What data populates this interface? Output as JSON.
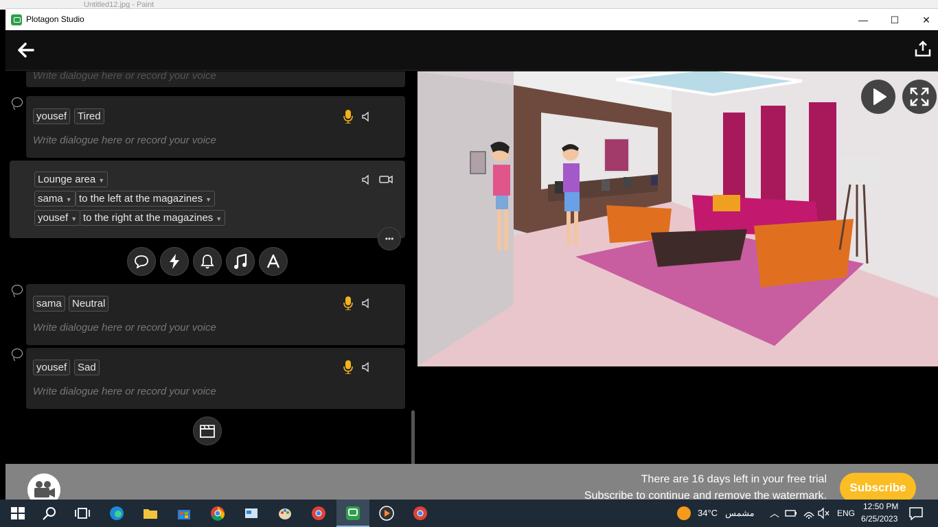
{
  "behind_window": {
    "title": "Untitled12.jpg - Paint"
  },
  "window": {
    "title": "Plotagon Studio",
    "controls": {
      "minimize": "—",
      "maximize": "☐",
      "close": "✕"
    }
  },
  "script": {
    "placeholder": "Write dialogue here or record your voice",
    "dialogues": [
      {
        "character": "yousef",
        "emotion": "Tired"
      },
      {
        "character": "sama",
        "emotion": "Neutral"
      },
      {
        "character": "yousef",
        "emotion": "Sad"
      }
    ],
    "scene": {
      "location": "Lounge area",
      "placements": [
        {
          "character": "sama",
          "position": "to the left at the magazines"
        },
        {
          "character": "yousef",
          "position": "to the right at the magazines"
        }
      ],
      "more_label": "•••"
    }
  },
  "banner": {
    "line1": "There are 16 days left in your free trial",
    "line2": "Subscribe to continue and remove the watermark.",
    "subscribe": "Subscribe"
  },
  "taskbar": {
    "weather_temp": "34°C",
    "weather_text": "مشمس",
    "language": "ENG",
    "time": "12:50 PM",
    "date": "6/25/2023"
  }
}
